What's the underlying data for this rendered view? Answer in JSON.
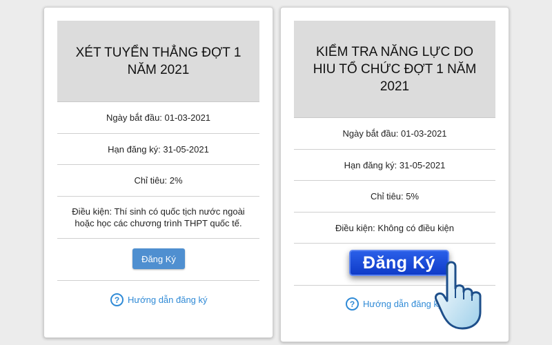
{
  "cards": [
    {
      "title": "XÉT TUYỂN THẲNG ĐỢT 1 NĂM 2021",
      "start_date": "Ngày bắt đầu: 01-03-2021",
      "deadline": "Hạn đăng ký: 31-05-2021",
      "quota": "Chỉ tiêu: 2%",
      "condition": "Điều kiện: Thí sinh có quốc tịch nước ngoài hoặc học các chương trình THPT quốc tế.",
      "register_label": "Đăng Ký",
      "help_label": "Hướng dẫn đăng ký"
    },
    {
      "title": "KIỂM TRA NĂNG LỰC DO HIU TỔ CHỨC ĐỢT 1 NĂM 2021",
      "start_date": "Ngày bắt đầu: 01-03-2021",
      "deadline": "Hạn đăng ký: 31-05-2021",
      "quota": "Chỉ tiêu: 5%",
      "condition": "Điều kiện: Không có điều kiện",
      "register_label": "Đăng Ký",
      "help_label": "Hướng dẫn đăng ký"
    }
  ],
  "icons": {
    "help": "question-circle-icon",
    "cursor": "hand-pointer-icon"
  },
  "colors": {
    "accent_button": "#4f8fd0",
    "highlight_button": "#1d49d8",
    "link": "#2f8ad6",
    "header_bg": "#dcdcdc"
  }
}
